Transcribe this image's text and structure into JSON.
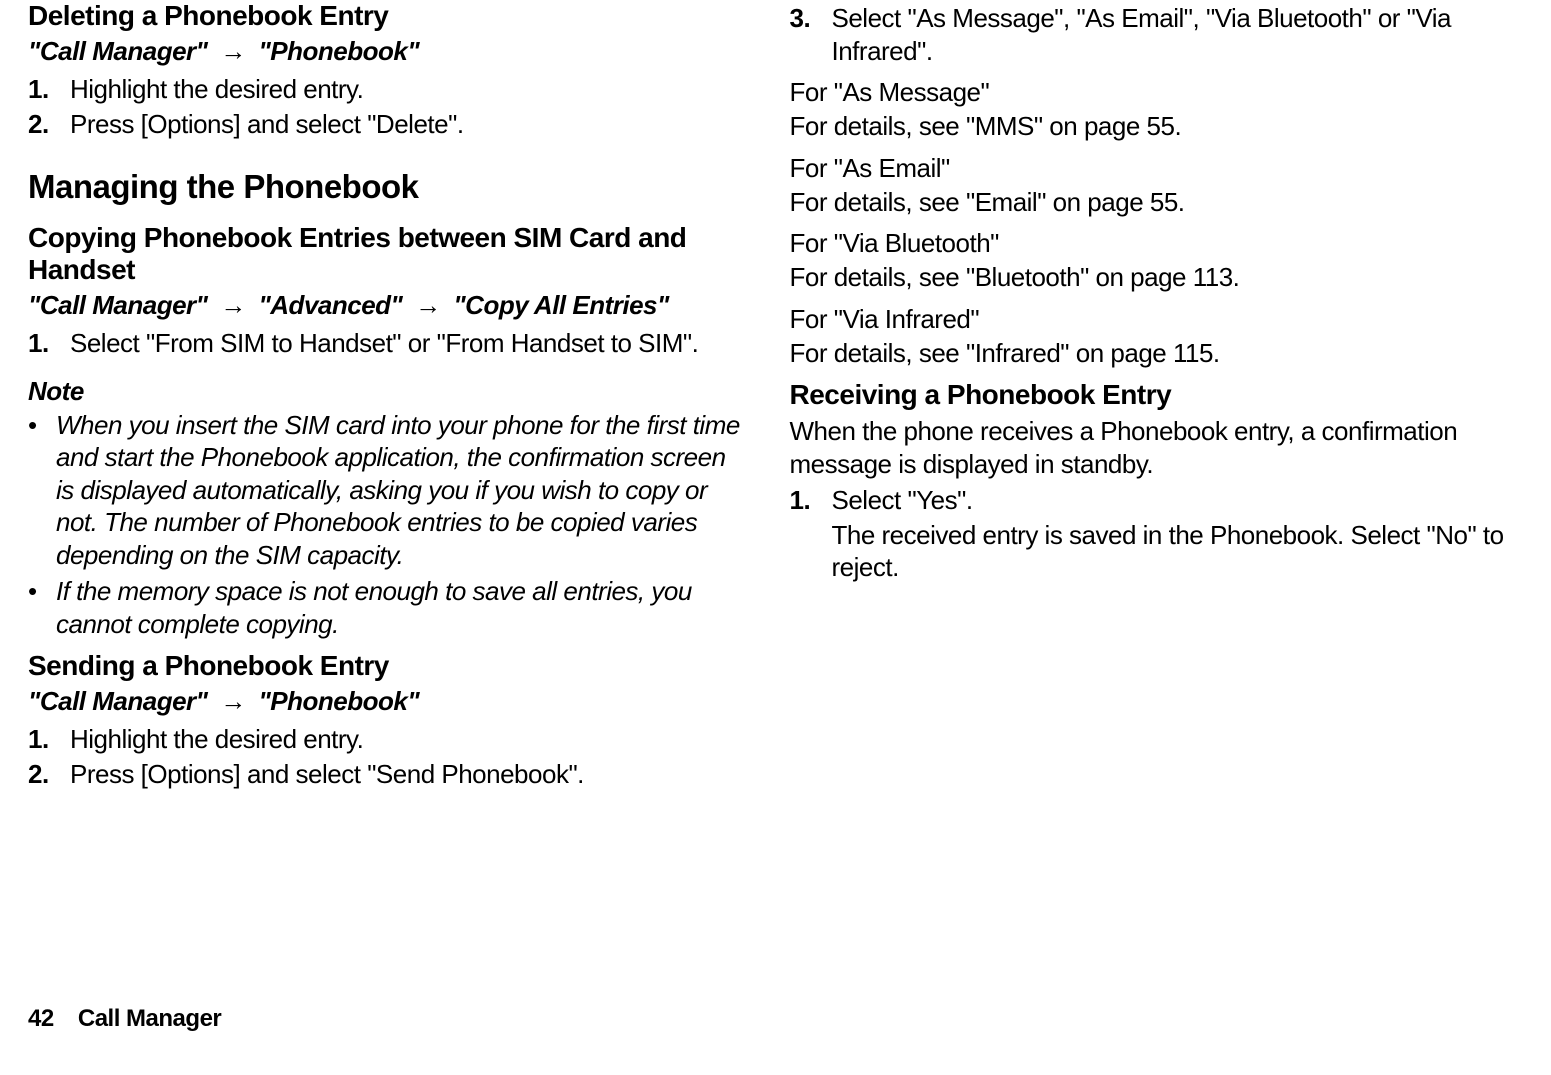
{
  "left": {
    "del_title": "Deleting a Phonebook Entry",
    "del_path_a": "\"Call Manager\"",
    "del_path_b": "\"Phonebook\"",
    "del_steps": [
      {
        "n": "1.",
        "t": "Highlight the desired entry."
      },
      {
        "n": "2.",
        "t": "Press [Options] and select \"Delete\"."
      }
    ],
    "mng_title": "Managing the Phonebook",
    "copy_title": "Copying Phonebook Entries between SIM Card and Handset",
    "copy_path_a": "\"Call Manager\"",
    "copy_path_b": "\"Advanced\"",
    "copy_path_c": "\"Copy All Entries\"",
    "copy_steps": [
      {
        "n": "1.",
        "t": "Select \"From SIM to Handset\" or \"From Handset to SIM\"."
      }
    ],
    "note_label": "Note",
    "notes": [
      "When you insert the SIM card into your phone for the first time and start the Phonebook application, the confirmation screen is displayed automatically, asking you if you wish to copy or not. The number of Phonebook entries to be copied varies depending on the SIM capacity.",
      "If the memory space is not enough to save all entries, you cannot complete copying."
    ],
    "send_title": "Sending a Phonebook Entry",
    "send_path_a": "\"Call Manager\"",
    "send_path_b": "\"Phonebook\"",
    "send_steps": [
      {
        "n": "1.",
        "t": "Highlight the desired entry."
      },
      {
        "n": "2.",
        "t": "Press [Options] and select \"Send Phonebook\"."
      }
    ]
  },
  "right": {
    "step3": {
      "n": "3.",
      "t": "Select \"As Message\", \"As Email\", \"Via Bluetooth\" or \"Via Infrared\"."
    },
    "for": [
      {
        "head": "For \"As Message\"",
        "body": "For details, see \"MMS\" on page 55."
      },
      {
        "head": "For \"As Email\"",
        "body": "For details, see \"Email\" on page 55."
      },
      {
        "head": "For \"Via Bluetooth\"",
        "body": "For details, see \"Bluetooth\" on page 113."
      },
      {
        "head": "For \"Via Infrared\"",
        "body": "For details, see \"Infrared\" on page 115."
      }
    ],
    "recv_title": "Receiving a Phonebook Entry",
    "recv_para": "When the phone receives a Phonebook entry, a confirmation message is displayed in standby.",
    "recv_steps": [
      {
        "n": "1.",
        "t": "Select \"Yes\".",
        "sub": "The received entry is saved in the Phonebook. Select \"No\" to reject."
      }
    ]
  },
  "footer": {
    "page": "42",
    "section": "Call Manager"
  },
  "arrow": "→"
}
